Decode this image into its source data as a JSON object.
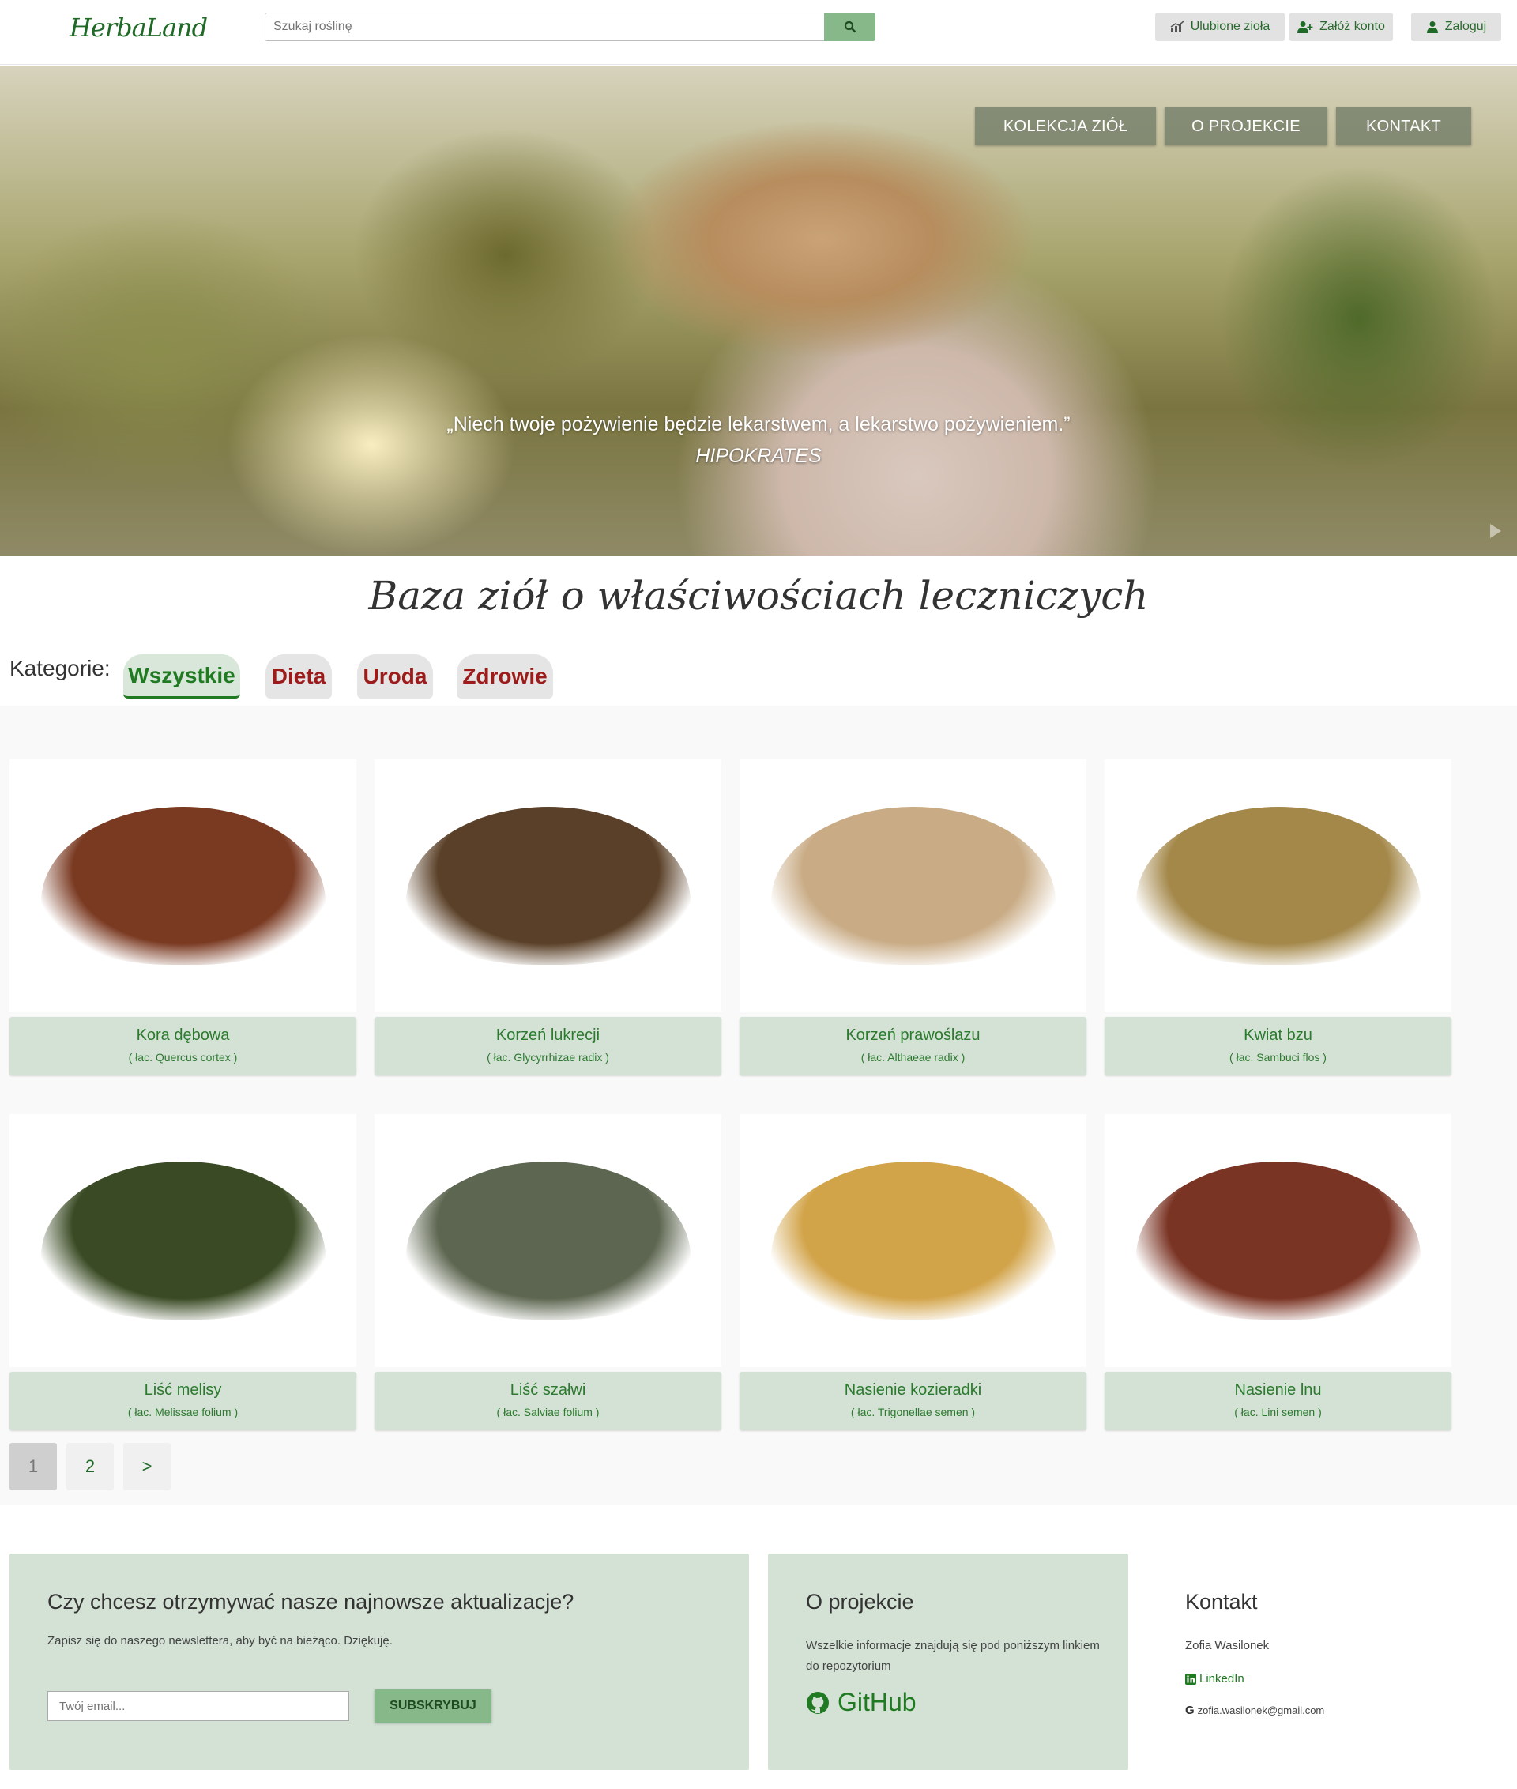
{
  "header": {
    "logo_text": "HerbaLand",
    "search_placeholder": "Szukaj roślinę",
    "buttons": {
      "favorites": "Ulubione zioła",
      "register": "Załóż konto",
      "login": "Zaloguj"
    }
  },
  "hero": {
    "nav": [
      "KOLEKCJA ZIÓŁ",
      "O PROJEKCIE",
      "KONTAKT"
    ],
    "quote": "„Niech twoje pożywienie będzie lekarstwem, a lekarstwo pożywieniem.”",
    "author": "HIPOKRATES"
  },
  "catalog": {
    "title": "Baza ziół o właściwościach leczniczych",
    "categories_label": "Kategorie:",
    "categories": [
      "Wszystkie",
      "Dieta",
      "Uroda",
      "Zdrowie"
    ],
    "active_category": "Wszystkie",
    "items": [
      {
        "name": "Kora dębowa",
        "latin": "( łac. Quercus cortex )",
        "color": "#7a3a22"
      },
      {
        "name": "Korzeń lukrecji",
        "latin": "( łac. Glycyrrhizae radix )",
        "color": "#5a4028"
      },
      {
        "name": "Korzeń prawoślazu",
        "latin": "( łac. Althaeae radix )",
        "color": "#c9ac86"
      },
      {
        "name": "Kwiat bzu",
        "latin": "( łac. Sambuci flos )",
        "color": "#a4884a"
      },
      {
        "name": "Liść melisy",
        "latin": "( łac. Melissae folium )",
        "color": "#3a4a24"
      },
      {
        "name": "Liść szałwi",
        "latin": "( łac. Salviae folium )",
        "color": "#5d6650"
      },
      {
        "name": "Nasienie kozieradki",
        "latin": "( łac. Trigonellae semen )",
        "color": "#d2a44a"
      },
      {
        "name": "Nasienie lnu",
        "latin": "( łac. Lini semen )",
        "color": "#7a3424"
      }
    ]
  },
  "pagination": {
    "pages": [
      "1",
      "2",
      ">"
    ],
    "current": "1"
  },
  "footer": {
    "newsletter": {
      "title": "Czy chcesz otrzymywać nasze najnowsze aktualizacje?",
      "text": "Zapisz się do naszego newslettera, aby być na bieżąco. Dziękuję.",
      "email_placeholder": "Twój email...",
      "button": "SUBSKRYBUJ"
    },
    "project": {
      "title": "O projekcie",
      "text": "Wszelkie informacje znajdują się pod poniższym linkiem do repozytorium",
      "link": "GitHub"
    },
    "contact": {
      "title": "Kontakt",
      "name": "Zofia Wasilonek",
      "linkedin": "LinkedIn",
      "email": "zofia.wasilonek@gmail.com"
    }
  },
  "colors": {
    "brand_green": "#1f7a22",
    "label_bg": "#d4e2d5",
    "button_green": "#87b889",
    "category_red": "#9c1c1c"
  }
}
